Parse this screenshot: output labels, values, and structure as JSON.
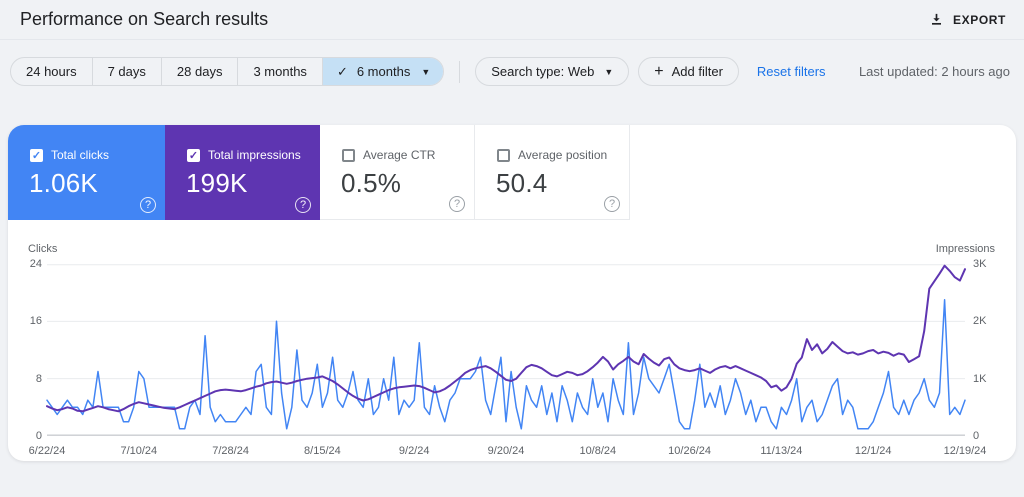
{
  "header": {
    "title": "Performance on Search results",
    "export_label": "EXPORT"
  },
  "filters": {
    "date_ranges": [
      "24 hours",
      "7 days",
      "28 days",
      "3 months"
    ],
    "selected_range": "6 months",
    "search_type_label": "Search type: Web",
    "add_filter_label": "Add filter",
    "reset_label": "Reset filters",
    "last_updated": "Last updated: 2 hours ago"
  },
  "metrics": [
    {
      "label": "Total clicks",
      "value": "1.06K",
      "checked": true,
      "color": "#4285f4"
    },
    {
      "label": "Total impressions",
      "value": "199K",
      "checked": true,
      "color": "#5e35b1"
    },
    {
      "label": "Average CTR",
      "value": "0.5%",
      "checked": false,
      "color": ""
    },
    {
      "label": "Average position",
      "value": "50.4",
      "checked": false,
      "color": ""
    }
  ],
  "chart_data": {
    "type": "line",
    "grid": true,
    "x_ticks": [
      "6/22/24",
      "7/10/24",
      "7/28/24",
      "8/15/24",
      "9/2/24",
      "9/20/24",
      "10/8/24",
      "10/26/24",
      "11/13/24",
      "12/1/24",
      "12/19/24"
    ],
    "left_axis": {
      "label": "Clicks",
      "max": 24,
      "ticks": [
        "24",
        "16",
        "8",
        "0"
      ]
    },
    "right_axis": {
      "label": "Impressions",
      "max": 3000,
      "ticks": [
        "3K",
        "2K",
        "1K",
        "0"
      ]
    },
    "series": [
      {
        "name": "Clicks",
        "axis": "left",
        "color": "#4285f4",
        "values": [
          5,
          4,
          3,
          4,
          5,
          4,
          4,
          3,
          5,
          4,
          9,
          4,
          4,
          4,
          4,
          2,
          2,
          4,
          9,
          8,
          4,
          4,
          4,
          4,
          4,
          4,
          1,
          1,
          4,
          5,
          3,
          14,
          4,
          2,
          3,
          2,
          2,
          2,
          3,
          4,
          3,
          9,
          10,
          4,
          3,
          16,
          6,
          1,
          4,
          12,
          5,
          4,
          6,
          10,
          4,
          6,
          11,
          5,
          4,
          6,
          9,
          5,
          4,
          8,
          3,
          4,
          8,
          5,
          11,
          3,
          5,
          4,
          5,
          13,
          4,
          3,
          7,
          4,
          2,
          5,
          6,
          8,
          8,
          8,
          9,
          11,
          5,
          3,
          7,
          11,
          2,
          9,
          4,
          1,
          7,
          5,
          4,
          7,
          3,
          6,
          2,
          7,
          5,
          2,
          6,
          4,
          3,
          8,
          4,
          6,
          2,
          8,
          5,
          3,
          13,
          3,
          6,
          11,
          8,
          7,
          6,
          8,
          10,
          6,
          2,
          1,
          1,
          5,
          10,
          4,
          6,
          4,
          7,
          3,
          5,
          8,
          6,
          3,
          5,
          2,
          4,
          4,
          2,
          1,
          4,
          3,
          5,
          8,
          2,
          4,
          5,
          2,
          3,
          5,
          7,
          8,
          3,
          5,
          4,
          1,
          1,
          1,
          2,
          4,
          6,
          9,
          4,
          3,
          5,
          3,
          5,
          6,
          8,
          5,
          4,
          6,
          19,
          3,
          4,
          3,
          5
        ]
      },
      {
        "name": "Impressions",
        "axis": "right",
        "color": "#5e35b1",
        "values": [
          520,
          480,
          450,
          470,
          500,
          480,
          440,
          430,
          460,
          490,
          520,
          500,
          470,
          450,
          430,
          470,
          520,
          560,
          590,
          570,
          550,
          530,
          510,
          490,
          480,
          470,
          500,
          540,
          580,
          620,
          660,
          700,
          740,
          780,
          800,
          810,
          800,
          790,
          780,
          800,
          830,
          860,
          880,
          920,
          940,
          950,
          930,
          910,
          930,
          960,
          980,
          1000,
          1010,
          1020,
          1040,
          1000,
          960,
          900,
          830,
          760,
          700,
          650,
          620,
          640,
          680,
          720,
          760,
          800,
          830,
          850,
          860,
          870,
          880,
          870,
          840,
          800,
          760,
          780,
          820,
          880,
          950,
          1020,
          1100,
          1150,
          1180,
          1200,
          1220,
          1180,
          1120,
          1050,
          980,
          960,
          1000,
          1100,
          1200,
          1240,
          1220,
          1180,
          1120,
          1060,
          1040,
          1080,
          1120,
          1100,
          1060,
          1080,
          1130,
          1200,
          1280,
          1380,
          1300,
          1160,
          1250,
          1310,
          1380,
          1300,
          1250,
          1430,
          1350,
          1280,
          1230,
          1340,
          1370,
          1250,
          1180,
          1150,
          1130,
          1150,
          1180,
          1140,
          1100,
          1160,
          1200,
          1220,
          1180,
          1220,
          1180,
          1140,
          1100,
          1060,
          1020,
          960,
          850,
          880,
          790,
          850,
          1000,
          1260,
          1370,
          1690,
          1500,
          1600,
          1440,
          1520,
          1640,
          1560,
          1480,
          1440,
          1460,
          1420,
          1440,
          1480,
          1500,
          1440,
          1470,
          1450,
          1400,
          1440,
          1420,
          1290,
          1340,
          1390,
          1830,
          2570,
          2700,
          2830,
          2970,
          2880,
          2770,
          2710,
          2910
        ]
      }
    ]
  }
}
